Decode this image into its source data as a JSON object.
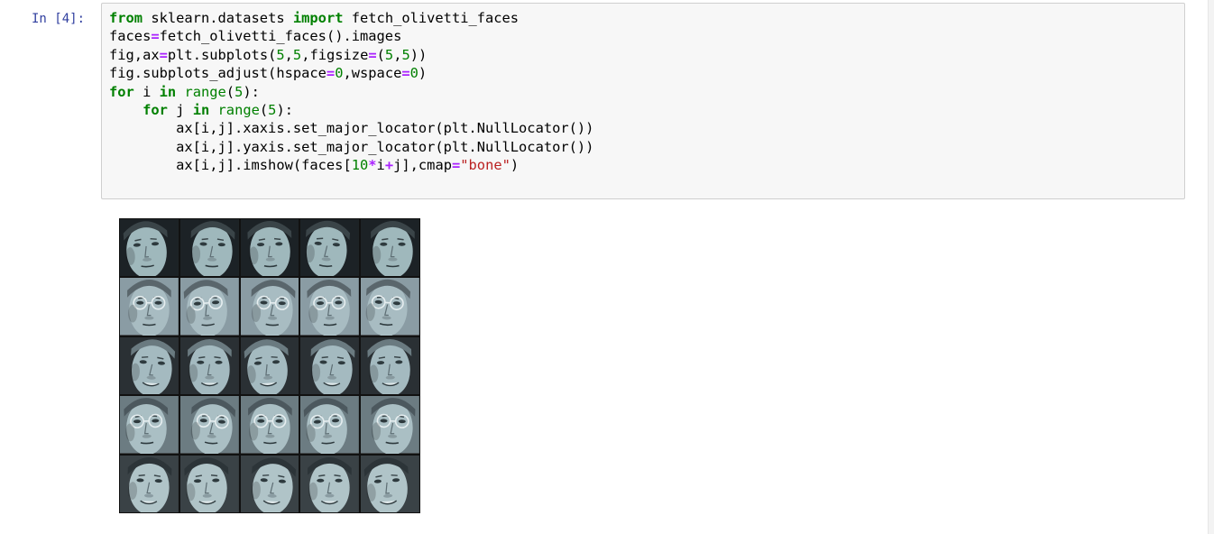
{
  "notebook": {
    "cell": {
      "prompt": "In [4]:",
      "code_lines": [
        [
          {
            "t": "from",
            "c": "kw"
          },
          {
            "t": " sklearn.datasets "
          },
          {
            "t": "import",
            "c": "kw"
          },
          {
            "t": " fetch_olivetti_faces"
          }
        ],
        [
          {
            "t": "faces"
          },
          {
            "t": "=",
            "c": "op"
          },
          {
            "t": "fetch_olivetti_faces().images"
          }
        ],
        [
          {
            "t": "fig,ax"
          },
          {
            "t": "=",
            "c": "op"
          },
          {
            "t": "plt.subplots("
          },
          {
            "t": "5",
            "c": "num"
          },
          {
            "t": ","
          },
          {
            "t": "5",
            "c": "num"
          },
          {
            "t": ",figsize"
          },
          {
            "t": "=",
            "c": "op"
          },
          {
            "t": "("
          },
          {
            "t": "5",
            "c": "num"
          },
          {
            "t": ","
          },
          {
            "t": "5",
            "c": "num"
          },
          {
            "t": "))"
          }
        ],
        [
          {
            "t": "fig.subplots_adjust(hspace"
          },
          {
            "t": "=",
            "c": "op"
          },
          {
            "t": "0",
            "c": "num"
          },
          {
            "t": ",wspace"
          },
          {
            "t": "=",
            "c": "op"
          },
          {
            "t": "0",
            "c": "num"
          },
          {
            "t": ")"
          }
        ],
        [
          {
            "t": "for",
            "c": "kw"
          },
          {
            "t": " i "
          },
          {
            "t": "in",
            "c": "kw"
          },
          {
            "t": " "
          },
          {
            "t": "range",
            "c": "bi"
          },
          {
            "t": "("
          },
          {
            "t": "5",
            "c": "num"
          },
          {
            "t": "):"
          }
        ],
        [
          {
            "t": "    "
          },
          {
            "t": "for",
            "c": "kw"
          },
          {
            "t": " j "
          },
          {
            "t": "in",
            "c": "kw"
          },
          {
            "t": " "
          },
          {
            "t": "range",
            "c": "bi"
          },
          {
            "t": "("
          },
          {
            "t": "5",
            "c": "num"
          },
          {
            "t": "):"
          }
        ],
        [
          {
            "t": "        ax[i,j].xaxis.set_major_locator(plt.NullLocator())"
          }
        ],
        [
          {
            "t": "        ax[i,j].yaxis.set_major_locator(plt.NullLocator())"
          }
        ],
        [
          {
            "t": "        ax[i,j].imshow(faces["
          },
          {
            "t": "10",
            "c": "num"
          },
          {
            "t": "*",
            "c": "op"
          },
          {
            "t": "i"
          },
          {
            "t": "+",
            "c": "op"
          },
          {
            "t": "j],cmap"
          },
          {
            "t": "=",
            "c": "op"
          },
          {
            "t": "\"bone\"",
            "c": "str"
          },
          {
            "t": ")"
          }
        ]
      ]
    },
    "output": {
      "figure": {
        "rows": 5,
        "cols": 5,
        "colormap": "bone",
        "row_styles": [
          {
            "bg": "#1c2226",
            "skin": "#9fb8bc",
            "hair": "#3a4448",
            "glasses": false,
            "smile": false
          },
          {
            "bg": "#8a9ca4",
            "skin": "#a8bcc2",
            "hair": "#5a666c",
            "glasses": true,
            "smile": false
          },
          {
            "bg": "#2a3034",
            "skin": "#a4bac0",
            "hair": "#6a7a80",
            "glasses": false,
            "smile": true
          },
          {
            "bg": "#6c7c82",
            "skin": "#aabfc4",
            "hair": "#4c585e",
            "glasses": true,
            "smile": false
          },
          {
            "bg": "#3a4246",
            "skin": "#b0c4c8",
            "hair": "#2c3438",
            "glasses": false,
            "smile": true
          }
        ]
      }
    }
  },
  "colors": {
    "keyword": "#008000",
    "operator": "#aa22ff",
    "string": "#ba2121",
    "prompt": "#303f9f"
  }
}
